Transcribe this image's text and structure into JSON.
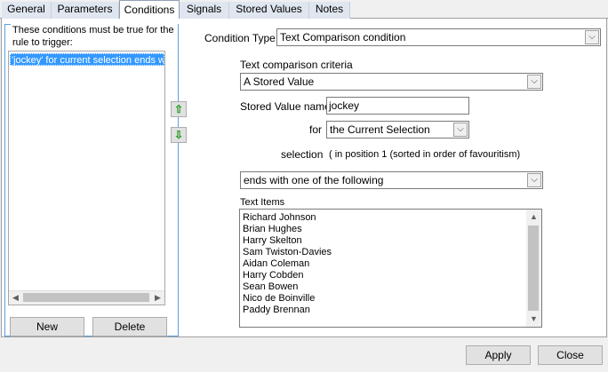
{
  "tabs": [
    {
      "label": "General"
    },
    {
      "label": "Parameters"
    },
    {
      "label": "Conditions"
    },
    {
      "label": "Signals"
    },
    {
      "label": "Stored Values"
    },
    {
      "label": "Notes"
    }
  ],
  "active_tab": "Conditions",
  "conditions_panel": {
    "title": "These conditions must be true for the rule to trigger:",
    "items": [
      "'jockey' for current selection ends with one of the following"
    ],
    "new_label": "New",
    "delete_label": "Delete"
  },
  "condition_type": {
    "label": "Condition Type",
    "value": "Text Comparison condition"
  },
  "criteria": {
    "label": "Text comparison criteria",
    "value": "A Stored Value"
  },
  "stored_value": {
    "label": "Stored Value name",
    "value": "jockey"
  },
  "for_field": {
    "label": "for",
    "value": "the Current Selection"
  },
  "selection": {
    "label": "selection",
    "value": "( in position 1 (sorted in order of favouritism)"
  },
  "comparison": {
    "value": "ends with one of the following"
  },
  "text_items": {
    "label": "Text Items",
    "items": [
      "Richard Johnson",
      "Brian Hughes",
      "Harry Skelton",
      "Sam Twiston-Davies",
      "Aidan Coleman",
      "Harry Cobden",
      "Sean Bowen",
      "Nico de Boinville",
      "Paddy Brennan"
    ]
  },
  "footer": {
    "apply_label": "Apply",
    "close_label": "Close"
  },
  "icons": {
    "move_up": "green-up-arrow-icon",
    "move_down": "green-down-arrow-icon",
    "dropdown": "chevron-down-icon"
  },
  "colors": {
    "selection": "#3399ff",
    "group_border": "#5aa0e0",
    "arrow_green": "#1a9a1a"
  }
}
